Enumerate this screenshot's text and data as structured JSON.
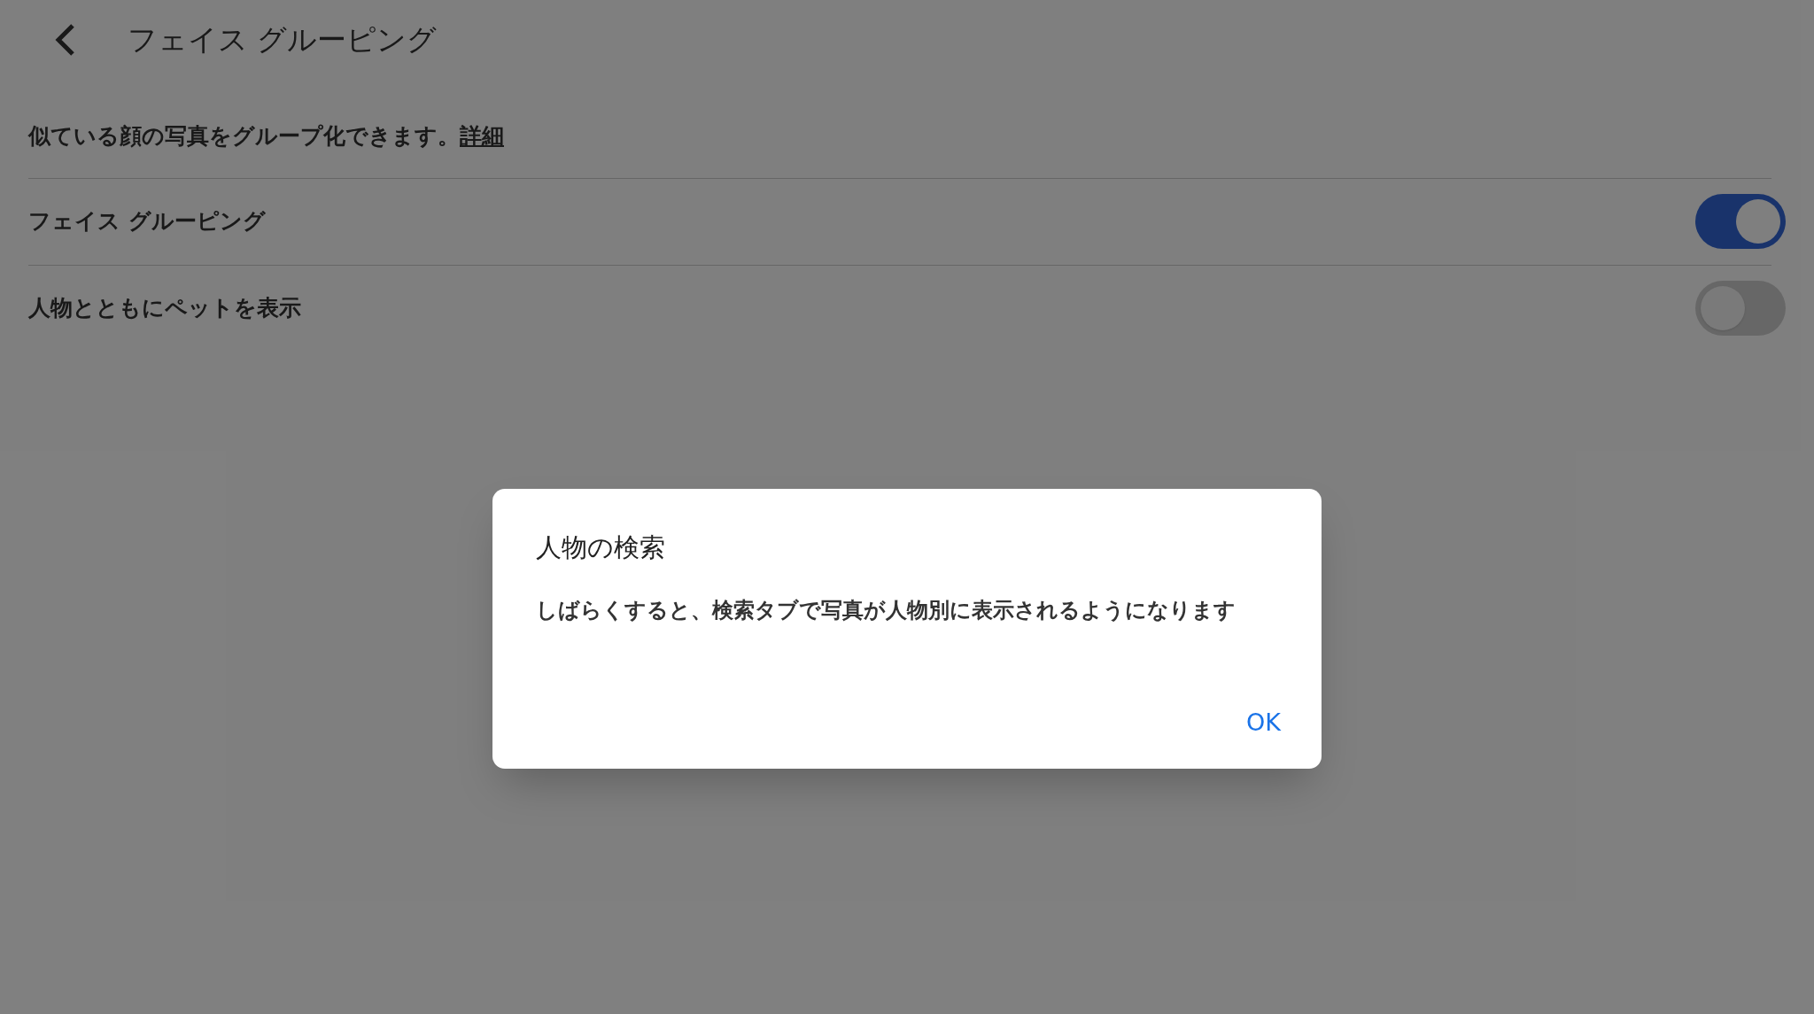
{
  "header": {
    "title": "フェイス グルーピング"
  },
  "description": {
    "text": "似ている顔の写真をグループ化できます。",
    "link": "詳細"
  },
  "settings": [
    {
      "label": "フェイス グルーピング",
      "on": true
    },
    {
      "label": "人物とともにペットを表示",
      "on": false
    }
  ],
  "dialog": {
    "title": "人物の検索",
    "message": "しばらくすると、検索タブで写真が人物別に表示されるようになります",
    "buttons": [
      "OK"
    ]
  }
}
